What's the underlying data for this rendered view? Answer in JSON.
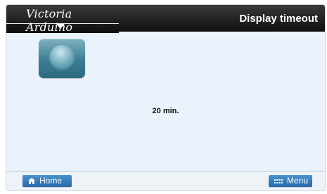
{
  "brand": {
    "logo_text": "Victoria Arduino"
  },
  "header": {
    "title": "Display timeout"
  },
  "setting": {
    "value_text": "20 min."
  },
  "footer": {
    "home_label": "Home",
    "menu_label": "Menu",
    "home_icon": "home-icon",
    "menu_icon": "menu-grid-icon"
  },
  "colors": {
    "header_bg": "#111111",
    "panel_bg": "#eaf3fb",
    "button_blue": "#2f75b6",
    "tile_teal": "#3b7f93"
  }
}
